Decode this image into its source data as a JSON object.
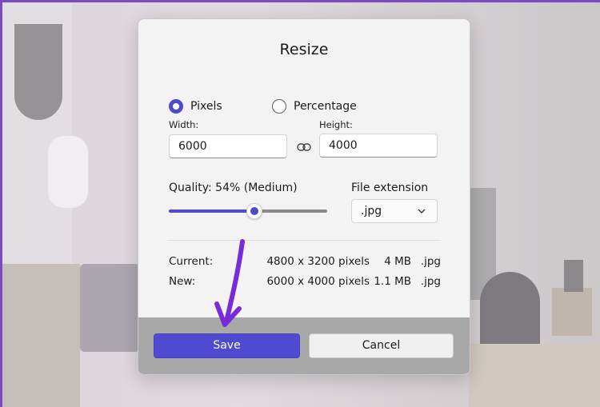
{
  "dialog": {
    "title": "Resize",
    "mode_options": [
      {
        "label": "Pixels",
        "selected": true
      },
      {
        "label": "Percentage",
        "selected": false
      }
    ],
    "width_label": "Width:",
    "width_value": "6000",
    "height_label": "Height:",
    "height_value": "4000",
    "link_icon": "link-chain-icon",
    "quality_label": "Quality: 54% (Medium)",
    "quality_level": 0.54,
    "file_extension_label": "File extension",
    "file_extension_value": ".jpg",
    "current": {
      "label": "Current:",
      "dimensions": "4800 x 3200 pixels",
      "size": "4 MB",
      "ext": ".jpg"
    },
    "new": {
      "label": "New:",
      "dimensions": "6000 x 4000 pixels",
      "size": "1.1 MB",
      "ext": ".jpg"
    },
    "save_label": "Save",
    "cancel_label": "Cancel"
  },
  "colors": {
    "accent": "#4f4bd0",
    "annotation_arrow": "#7a2bd9"
  }
}
